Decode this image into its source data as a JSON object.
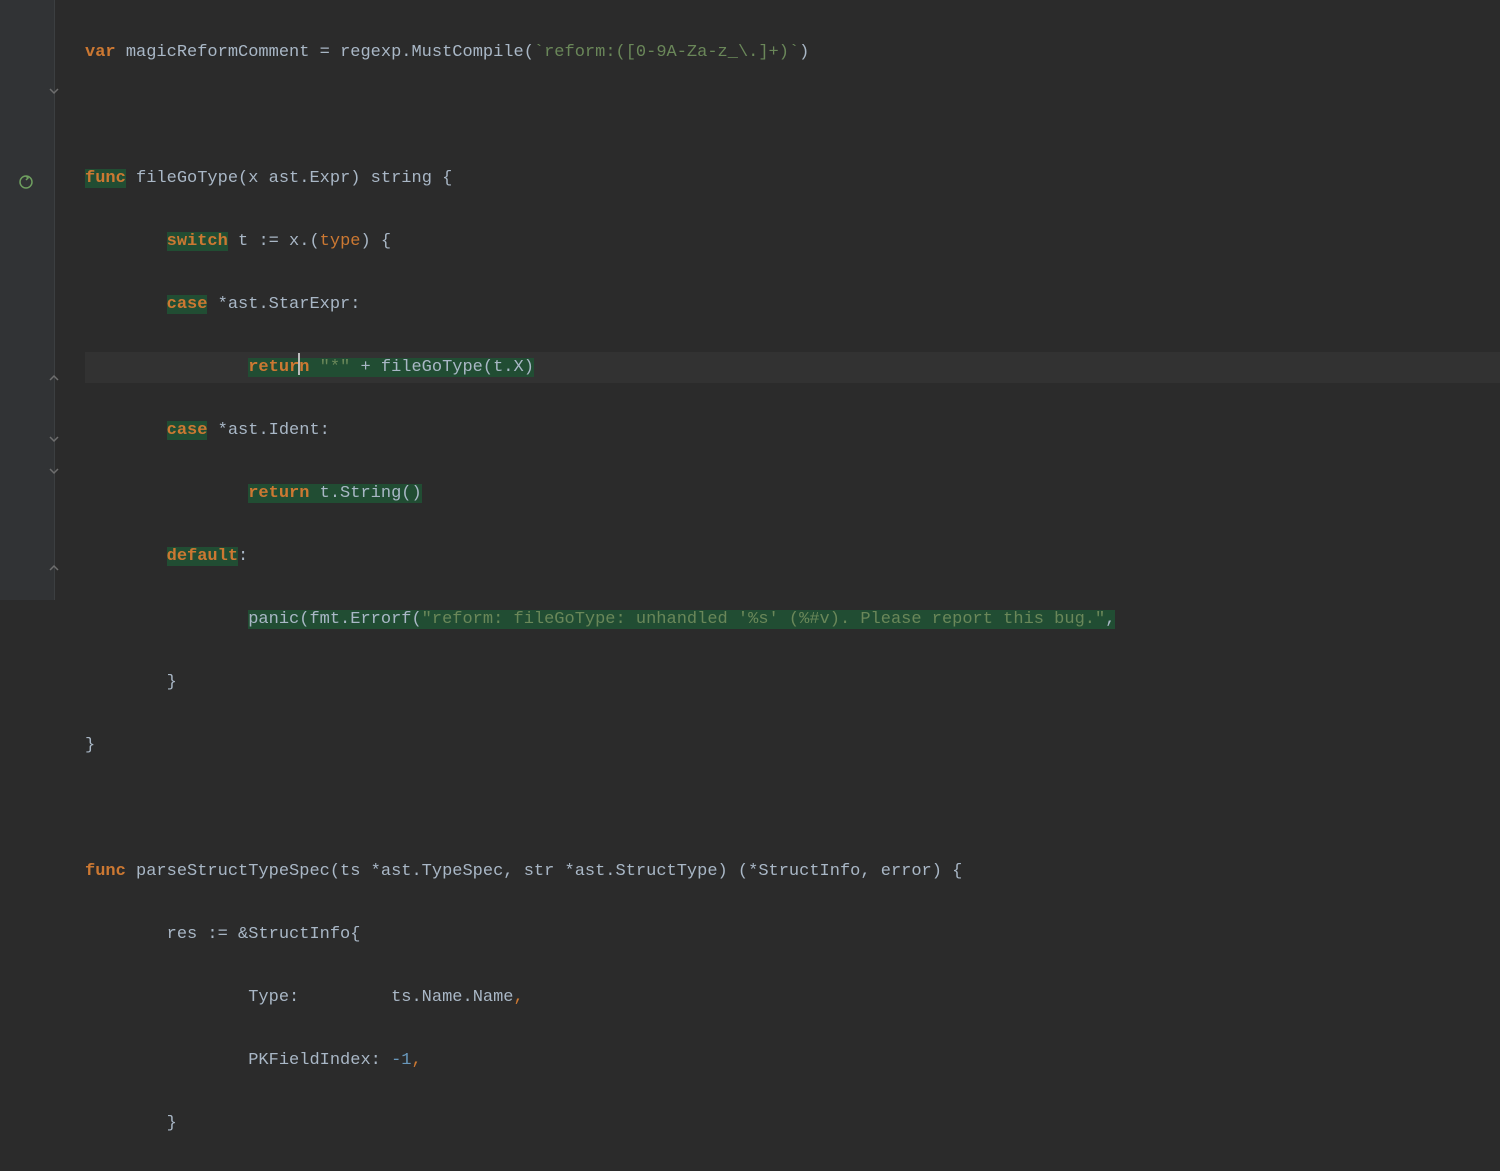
{
  "code": {
    "line1": {
      "var": "var",
      "name": "magicReformComment",
      "eq": " = ",
      "pkg": "regexp",
      "dot": ".",
      "fn": "MustCompile",
      "open": "(",
      "str": "`reform:([0-9A-Za-z_\\.]+)`",
      "close": ")"
    },
    "line3": {
      "func": "func",
      "name": "fileGoType",
      "params_open": "(",
      "param1": "x ast",
      "param1b": ".Expr",
      "params_close": ")",
      "ret": " string ",
      "brace": "{"
    },
    "line4": {
      "switch": "switch",
      "rest": " t := x.(",
      "type": "type",
      "close": ") {"
    },
    "line5": {
      "case": "case",
      "rest": " *ast.StarExpr:"
    },
    "line6": {
      "return": "return",
      "str": " \"*\" ",
      "plus": "+ fileGoType(t.X)"
    },
    "line7": {
      "case": "case",
      "rest": " *ast.Ident:"
    },
    "line8": {
      "return": "return",
      "rest": " t.String()"
    },
    "line9": {
      "default": "default",
      "colon": ":"
    },
    "line10": {
      "panic": "panic",
      "open": "(fmt.Errorf(",
      "str": "\"reform: fileGoType: unhandled '%s' (%#v). Please report this bug.\"",
      "after": ","
    },
    "line11": {
      "brace": "}"
    },
    "line12": {
      "brace": "}"
    },
    "line14": {
      "func": "func",
      "name": " parseStructTypeSpec",
      "params": "(ts *ast.TypeSpec, str *ast.StructType) (*StructInfo, error) {"
    },
    "line15": {
      "text": "res := &StructInfo{"
    },
    "line16": {
      "field": "Type:",
      "pad": "         ",
      "val": "ts.Name.Name",
      "comma": ","
    },
    "line17": {
      "field": "PKFieldIndex:",
      "pad": " ",
      "val": "-1",
      "comma": ","
    },
    "line18": {
      "brace": "}"
    }
  },
  "gutter": {
    "rerun_tooltip": "Rerun",
    "fold_tooltip": "Collapse"
  }
}
